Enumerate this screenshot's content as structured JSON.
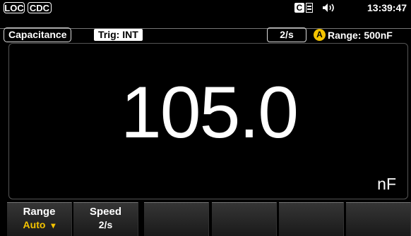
{
  "status_bar": {
    "loc": "LOC",
    "cdc": "CDC",
    "icon_c": "C",
    "time": "13:39:47"
  },
  "info_bar": {
    "mode": "Capacitance",
    "trigger": "Trig: INT",
    "speed": "2/s",
    "auto_badge": "A",
    "range": "Range: 500nF"
  },
  "display": {
    "reading": "105.0",
    "unit": "nF"
  },
  "softkeys": [
    {
      "label": "Range",
      "value": "Auto"
    },
    {
      "label": "Speed",
      "value": "2/s"
    },
    {
      "label": "",
      "value": ""
    },
    {
      "label": "",
      "value": ""
    },
    {
      "label": "",
      "value": ""
    },
    {
      "label": "",
      "value": ""
    }
  ],
  "colors": {
    "accent": "#f5c400",
    "background": "#000000"
  }
}
